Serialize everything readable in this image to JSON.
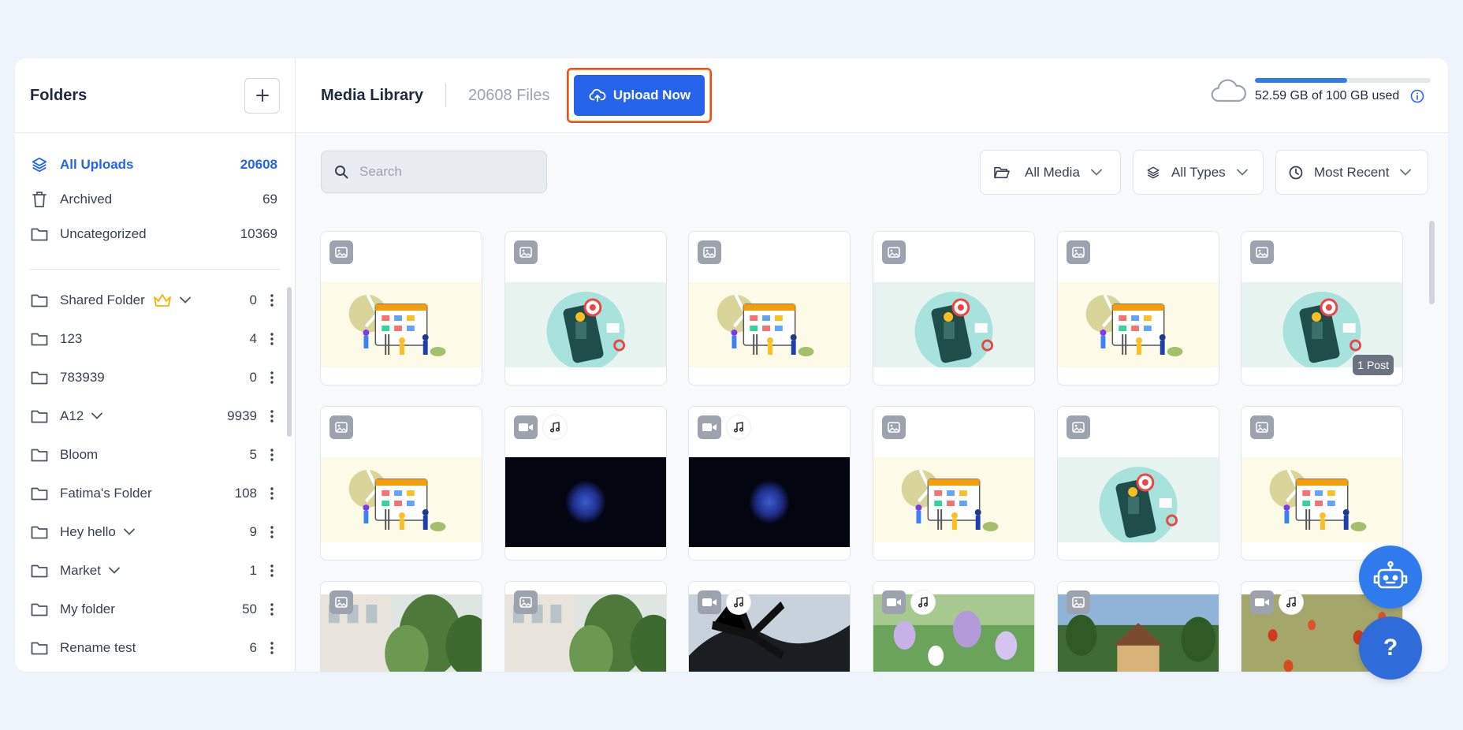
{
  "sidebar": {
    "title": "Folders",
    "system_items": [
      {
        "label": "All Uploads",
        "count": "20608",
        "icon": "layers-icon",
        "active": true
      },
      {
        "label": "Archived",
        "count": "69",
        "icon": "trash-icon"
      },
      {
        "label": "Uncategorized",
        "count": "10369",
        "icon": "folder-icon"
      }
    ],
    "folders": [
      {
        "label": "Shared Folder",
        "count": "0",
        "crown": true,
        "expandable": true
      },
      {
        "label": "123",
        "count": "4"
      },
      {
        "label": "783939",
        "count": "0"
      },
      {
        "label": "A12",
        "count": "9939",
        "expandable": true
      },
      {
        "label": "Bloom",
        "count": "5"
      },
      {
        "label": "Fatima's Folder",
        "count": "108"
      },
      {
        "label": "Hey hello",
        "count": "9",
        "expandable": true
      },
      {
        "label": "Market",
        "count": "1",
        "expandable": true
      },
      {
        "label": "My folder",
        "count": "50"
      },
      {
        "label": "Rename test",
        "count": "6"
      }
    ]
  },
  "header": {
    "title": "Media Library",
    "files_count": "20608 Files",
    "upload_label": "Upload Now",
    "storage_text": "52.59 GB of 100 GB used",
    "storage_fraction": 0.5259
  },
  "toolbar": {
    "search_placeholder": "Search",
    "filters": [
      {
        "label": "All Media",
        "icon": "folder-open-icon"
      },
      {
        "label": "All Types",
        "icon": "layers-icon"
      },
      {
        "label": "Most Recent",
        "icon": "clock-icon"
      }
    ]
  },
  "media": {
    "post_tag": "1 Post",
    "items": [
      {
        "kind": "image",
        "art": "calendar"
      },
      {
        "kind": "image",
        "art": "phone"
      },
      {
        "kind": "image",
        "art": "calendar"
      },
      {
        "kind": "image",
        "art": "phone"
      },
      {
        "kind": "image",
        "art": "calendar"
      },
      {
        "kind": "image",
        "art": "phone",
        "posted": true
      },
      {
        "kind": "image",
        "art": "calendar"
      },
      {
        "kind": "video",
        "art": "space"
      },
      {
        "kind": "video",
        "art": "space"
      },
      {
        "kind": "image",
        "art": "calendar"
      },
      {
        "kind": "image",
        "art": "phone"
      },
      {
        "kind": "image",
        "art": "calendar"
      },
      {
        "kind": "image",
        "art": "street"
      },
      {
        "kind": "image",
        "art": "street"
      },
      {
        "kind": "video",
        "art": "palm"
      },
      {
        "kind": "video",
        "art": "flowers"
      },
      {
        "kind": "image",
        "art": "house"
      },
      {
        "kind": "video",
        "art": "poppies"
      }
    ]
  },
  "colors": {
    "accent": "#2563eb",
    "highlight_border": "#e74c3c",
    "background": "#eef4fc"
  }
}
